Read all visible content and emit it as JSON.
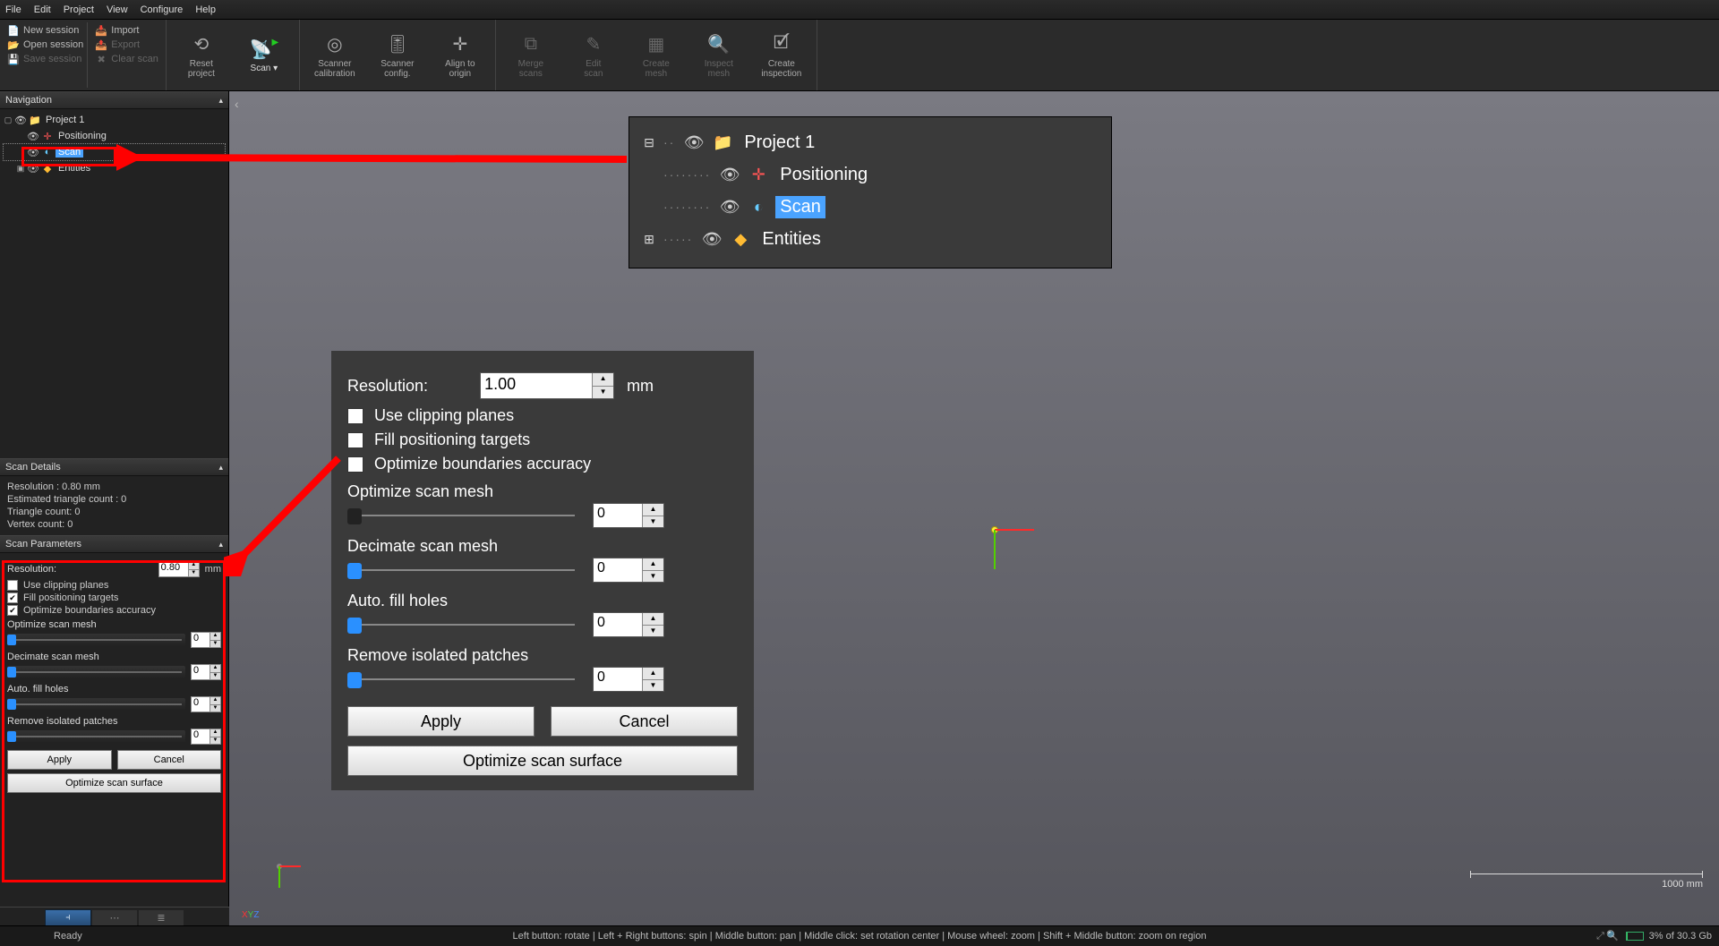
{
  "menu": {
    "file": "File",
    "edit": "Edit",
    "project": "Project",
    "view": "View",
    "configure": "Configure",
    "help": "Help"
  },
  "toolbar": {
    "new_session": "New session",
    "open_session": "Open session",
    "save_session": "Save session",
    "import": "Import",
    "export": "Export",
    "clear_scan": "Clear scan",
    "reset_project": "Reset\nproject",
    "scan": "Scan",
    "scanner_calibration": "Scanner\ncalibration",
    "scanner_config": "Scanner\nconfig.",
    "align_to_origin": "Align to\norigin",
    "merge_scans": "Merge\nscans",
    "edit_scan": "Edit\nscan",
    "create_mesh": "Create\nmesh",
    "inspect_mesh": "Inspect\nmesh",
    "create_inspection": "Create\ninspection"
  },
  "nav": {
    "title": "Navigation",
    "project": "Project 1",
    "positioning": "Positioning",
    "scan": "Scan",
    "entities": "Entities"
  },
  "details": {
    "title": "Scan Details",
    "resolution": "Resolution : 0.80 mm",
    "est_tri": "Estimated triangle count : 0",
    "tri": "Triangle count: 0",
    "vert": "Vertex count: 0"
  },
  "params_small": {
    "title": "Scan Parameters",
    "resolution_label": "Resolution:",
    "resolution_value": "0.80",
    "mm": "mm",
    "use_clipping": "Use clipping planes",
    "fill_targets": "Fill positioning targets",
    "opt_bound": "Optimize boundaries accuracy",
    "opt_mesh": "Optimize scan mesh",
    "decimate": "Decimate scan mesh",
    "fill_holes": "Auto. fill holes",
    "remove_patches": "Remove isolated patches",
    "zero": "0",
    "apply": "Apply",
    "cancel": "Cancel",
    "opt_surface": "Optimize scan surface",
    "check_fill_targets": true,
    "check_opt_bound": true,
    "check_use_clipping": false
  },
  "params_big": {
    "resolution_label": "Resolution:",
    "resolution_value": "1.00",
    "mm": "mm",
    "use_clipping": "Use clipping planes",
    "fill_targets": "Fill positioning targets",
    "opt_bound": "Optimize boundaries accuracy",
    "opt_mesh": "Optimize scan mesh",
    "decimate": "Decimate scan mesh",
    "fill_holes": "Auto. fill holes",
    "remove_patches": "Remove isolated patches",
    "zero": "0",
    "apply": "Apply",
    "cancel": "Cancel",
    "opt_surface": "Optimize scan surface"
  },
  "bigtree": {
    "project": "Project 1",
    "positioning": "Positioning",
    "scan": "Scan",
    "entities": "Entities"
  },
  "scale": {
    "label": "1000 mm"
  },
  "xyz": {
    "x": "X",
    "y": "Y",
    "z": "Z"
  },
  "status": {
    "ready": "Ready",
    "hints": "Left button: rotate  |  Left + Right buttons: spin  |  Middle button: pan  |  Middle click: set rotation center  |  Mouse wheel: zoom  |  Shift + Middle button: zoom on region",
    "mem": "3% of 30.3 Gb"
  }
}
